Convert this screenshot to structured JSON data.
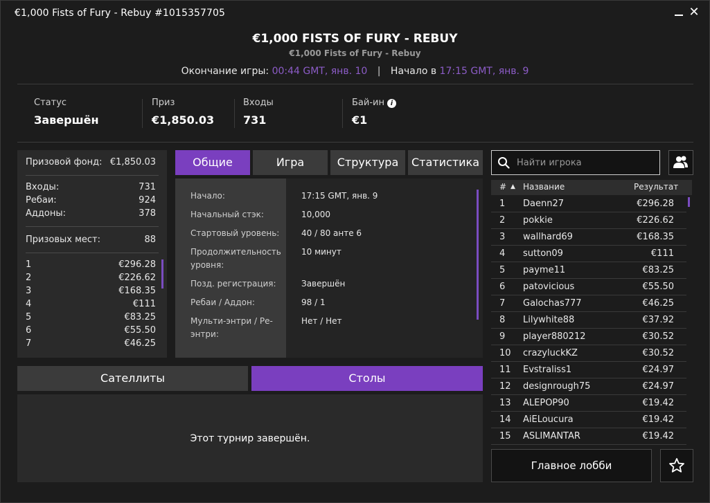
{
  "window": {
    "title": "€1,000 Fists of Fury - Rebuy #1015357705",
    "close_glyph": "✕"
  },
  "header": {
    "title": "€1,000 FISTS OF FURY - REBUY",
    "subtitle": "€1,000 Fists of Fury - Rebuy",
    "end_label": "Окончание игры:",
    "end_value": "00:44 GMT, янв. 10",
    "separator": "|",
    "start_label": "Начало в",
    "start_value": "17:15 GMT, янв. 9"
  },
  "info": [
    {
      "label": "Статус",
      "value": "Завершён"
    },
    {
      "label": "Приз",
      "value": "€1,850.03"
    },
    {
      "label": "Входы",
      "value": "731"
    },
    {
      "label": "Бай-ин",
      "value": "€1"
    }
  ],
  "left_panel": {
    "prize_fund_label": "Призовой фонд:",
    "prize_fund_value": "€1,850.03",
    "entries_label": "Входы:",
    "entries_value": "731",
    "rebuys_label": "Ребаи:",
    "rebuys_value": "924",
    "addons_label": "Аддоны:",
    "addons_value": "378",
    "places_label": "Призовых мест:",
    "places_value": "88",
    "payouts": [
      {
        "place": "1",
        "amount": "€296.28"
      },
      {
        "place": "2",
        "amount": "€226.62"
      },
      {
        "place": "3",
        "amount": "€168.35"
      },
      {
        "place": "4",
        "amount": "€111"
      },
      {
        "place": "5",
        "amount": "€83.25"
      },
      {
        "place": "6",
        "amount": "€55.50"
      },
      {
        "place": "7",
        "amount": "€46.25"
      }
    ]
  },
  "tabs": [
    "Общие",
    "Игра",
    "Структура",
    "Статистика"
  ],
  "general": [
    {
      "label": "Начало:",
      "value": "17:15 GMT, янв. 9"
    },
    {
      "label": "Начальный стэк:",
      "value": "10,000"
    },
    {
      "label": "Стартовый уровень:",
      "value": "40 / 80 анте 6"
    },
    {
      "label": "Продолжительность уровня:",
      "value": "10 минут"
    },
    {
      "label": "Позд. регистрация:",
      "value": "Завершён"
    },
    {
      "label": "Ребаи / Аддон:",
      "value": "98 / 1"
    },
    {
      "label": "Мульти-энтри / Ре-энтри:",
      "value": "Нет / Нет"
    }
  ],
  "bottom_tabs": [
    "Сателлиты",
    "Столы"
  ],
  "bottom_message": "Этот турнир завершён.",
  "search": {
    "placeholder": "Найти игрока"
  },
  "results": {
    "col_rank": "#",
    "sort_glyph": "▲",
    "col_name": "Название",
    "col_result": "Результат",
    "rows": [
      {
        "rank": "1",
        "name": "Daenn27",
        "result": "€296.28"
      },
      {
        "rank": "2",
        "name": "pokkie",
        "result": "€226.62"
      },
      {
        "rank": "3",
        "name": "wallhard69",
        "result": "€168.35"
      },
      {
        "rank": "4",
        "name": "sutton09",
        "result": "€111"
      },
      {
        "rank": "5",
        "name": "payme11",
        "result": "€83.25"
      },
      {
        "rank": "6",
        "name": "patovicious",
        "result": "€55.50"
      },
      {
        "rank": "7",
        "name": "Galochas777",
        "result": "€46.25"
      },
      {
        "rank": "8",
        "name": "Lilywhite88",
        "result": "€37.92"
      },
      {
        "rank": "9",
        "name": "player880212",
        "result": "€30.52"
      },
      {
        "rank": "10",
        "name": "crazyluckKZ",
        "result": "€30.52"
      },
      {
        "rank": "11",
        "name": "Evstraliss1",
        "result": "€24.97"
      },
      {
        "rank": "12",
        "name": "designrough75",
        "result": "€24.97"
      },
      {
        "rank": "13",
        "name": "ALEPOP90",
        "result": "€19.42"
      },
      {
        "rank": "14",
        "name": "AiELoucura",
        "result": "€19.42"
      },
      {
        "rank": "15",
        "name": "ASLIMANTAR",
        "result": "€19.42"
      }
    ]
  },
  "lobby_button": "Главное лобби",
  "colors": {
    "accent": "#7a3fbf",
    "time_highlight": "#8c5cc7"
  }
}
